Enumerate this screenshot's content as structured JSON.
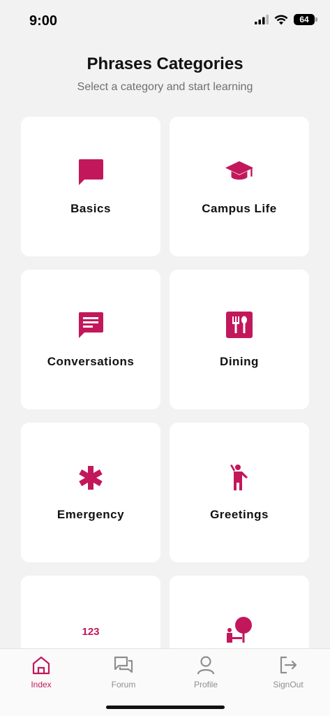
{
  "status": {
    "time": "9:00",
    "battery": "64"
  },
  "header": {
    "title": "Phrases Categories",
    "subtitle": "Select a category and start learning"
  },
  "accent_color": "#c2185b",
  "categories": [
    {
      "label": "Basics",
      "icon": "chat-bubble-icon"
    },
    {
      "label": "Campus Life",
      "icon": "graduation-cap-icon"
    },
    {
      "label": "Conversations",
      "icon": "message-lines-icon"
    },
    {
      "label": "Dining",
      "icon": "fork-spoon-icon"
    },
    {
      "label": "Emergency",
      "icon": "asterisk-icon"
    },
    {
      "label": "Greetings",
      "icon": "person-waving-icon"
    },
    {
      "label": "",
      "icon": "numbers-123-icon"
    },
    {
      "label": "",
      "icon": "person-tree-icon"
    }
  ],
  "tabs": [
    {
      "label": "Index",
      "icon": "home-icon",
      "active": true
    },
    {
      "label": "Forum",
      "icon": "forum-icon",
      "active": false
    },
    {
      "label": "Profile",
      "icon": "person-icon",
      "active": false
    },
    {
      "label": "SignOut",
      "icon": "sign-out-icon",
      "active": false
    }
  ]
}
